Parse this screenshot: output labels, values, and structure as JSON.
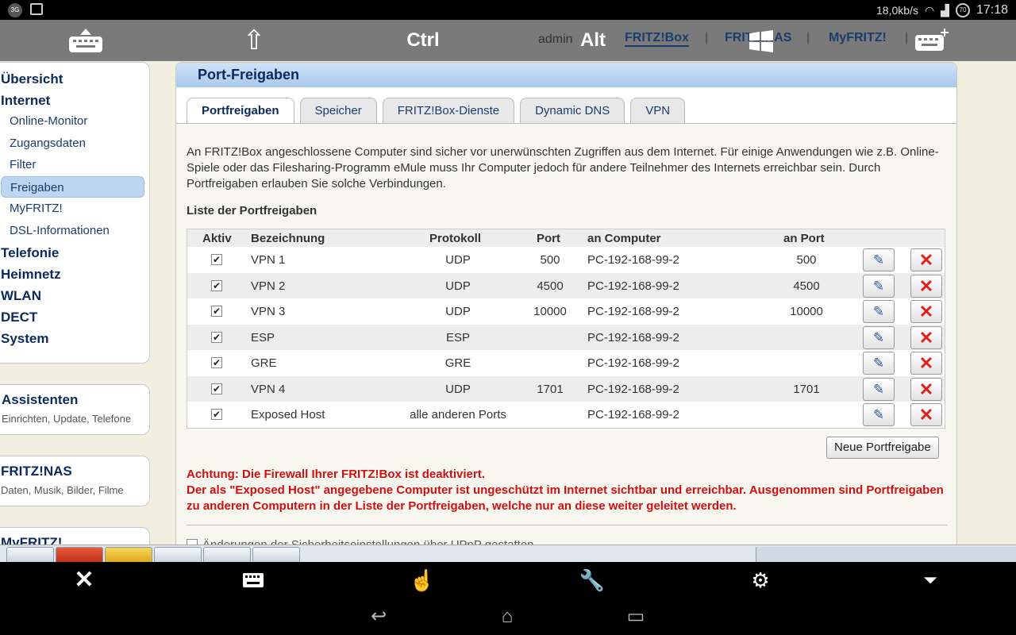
{
  "statusbar": {
    "network_badge": "3G",
    "speed": "18,0kb/s",
    "battery": "70",
    "time": "17:18"
  },
  "remote_toolbar": {
    "shift_icon": "⇧",
    "ctrl": "Ctrl",
    "admin": "admin",
    "alt": "Alt",
    "top_nav": [
      "FRITZ!Box",
      "FRITZ!NAS",
      "MyFRITZ!"
    ]
  },
  "sidebar": {
    "menu": [
      {
        "label": "Übersicht",
        "level": "main"
      },
      {
        "label": "Internet",
        "level": "main"
      },
      {
        "label": "Online-Monitor",
        "level": "sub"
      },
      {
        "label": "Zugangsdaten",
        "level": "sub"
      },
      {
        "label": "Filter",
        "level": "sub"
      },
      {
        "label": "Freigaben",
        "level": "sub",
        "active": true
      },
      {
        "label": "MyFRITZ!",
        "level": "sub"
      },
      {
        "label": "DSL-Informationen",
        "level": "sub"
      },
      {
        "label": "Telefonie",
        "level": "main"
      },
      {
        "label": "Heimnetz",
        "level": "main"
      },
      {
        "label": "WLAN",
        "level": "main"
      },
      {
        "label": "DECT",
        "level": "main"
      },
      {
        "label": "System",
        "level": "main"
      }
    ],
    "assistenten": {
      "title": "Assistenten",
      "sub": "Einrichten, Update, Telefone"
    },
    "nas": {
      "title": "FRITZ!NAS",
      "sub": "Daten, Musik, Bilder, Filme"
    },
    "myfritz": {
      "title": "MyFRITZ!"
    }
  },
  "main": {
    "title": "Port-Freigaben",
    "tabs": [
      "Portfreigaben",
      "Speicher",
      "FRITZ!Box-Dienste",
      "Dynamic DNS",
      "VPN"
    ],
    "intro": "An FRITZ!Box angeschlossene Computer sind sicher vor unerwünschten Zugriffen aus dem Internet. Für einige Anwendungen wie z.B. Online-Spiele oder das Filesharing-Programm eMule muss Ihr Computer jedoch für andere Teilnehmer des Internets erreichbar sein. Durch Portfreigaben erlauben Sie solche Verbindungen.",
    "list_title": "Liste der Portfreigaben",
    "columns": [
      "Aktiv",
      "Bezeichnung",
      "Protokoll",
      "Port",
      "an Computer",
      "an Port"
    ],
    "rows": [
      {
        "active": true,
        "name": "VPN 1",
        "protocol": "UDP",
        "port": "500",
        "computer": "PC-192-168-99-2",
        "to_port": "500"
      },
      {
        "active": true,
        "name": "VPN 2",
        "protocol": "UDP",
        "port": "4500",
        "computer": "PC-192-168-99-2",
        "to_port": "4500"
      },
      {
        "active": true,
        "name": "VPN 3",
        "protocol": "UDP",
        "port": "10000",
        "computer": "PC-192-168-99-2",
        "to_port": "10000"
      },
      {
        "active": true,
        "name": "ESP",
        "protocol": "ESP",
        "port": "",
        "computer": "PC-192-168-99-2",
        "to_port": ""
      },
      {
        "active": true,
        "name": "GRE",
        "protocol": "GRE",
        "port": "",
        "computer": "PC-192-168-99-2",
        "to_port": ""
      },
      {
        "active": true,
        "name": "VPN 4",
        "protocol": "UDP",
        "port": "1701",
        "computer": "PC-192-168-99-2",
        "to_port": "1701"
      },
      {
        "active": true,
        "name": "Exposed Host",
        "protocol": "alle anderen Ports",
        "port": "",
        "computer": "PC-192-168-99-2",
        "to_port": ""
      }
    ],
    "new_button": "Neue Portfreigabe",
    "warning_line1": "Achtung: Die Firewall Ihrer FRITZ!Box ist deaktiviert.",
    "warning_line2": "Der als \"Exposed Host\" angegebene Computer ist ungeschützt im Internet sichtbar und erreichbar. Ausgenommen sind Portfreigaben zu anderen Computern in der Liste der Portfreigaben, welche nur an diese weiter geleitet werden.",
    "upnp_label": "Änderungen der Sicherheitseinstellungen über UPnP gestatten"
  },
  "colors": {
    "accent": "#0b2a5e",
    "warning": "#d01010",
    "active_nav": "#bcd6f2",
    "header_blue": "#a9c9ec"
  }
}
